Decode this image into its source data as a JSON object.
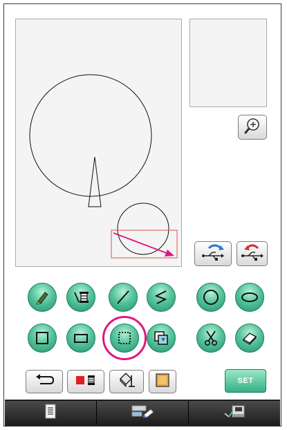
{
  "toolbar": {
    "set_label": "SET"
  },
  "icons": {
    "zoom": "zoom-in-magnifier-icon",
    "usb_save": "usb-save-icon",
    "usb_load": "usb-load-icon",
    "tools_row1": [
      "pencil-icon",
      "line-property-icon",
      "straight-line-icon",
      "polyline-icon",
      "circle-icon",
      "ellipse-icon"
    ],
    "tools_row2": [
      "square-icon",
      "rectangle-icon",
      "select-area-icon",
      "copy-paste-icon",
      "scissors-icon",
      "eraser-icon"
    ],
    "bottom": [
      "undo-icon",
      "color-picker-icon",
      "fill-bucket-icon",
      "line-fill-select-icon"
    ],
    "tabs": [
      "document-icon",
      "edit-stitch-icon",
      "sewing-machine-icon"
    ]
  },
  "colors": {
    "accent_green": "#34b083",
    "selection_ring": "#e0177f",
    "selection_box": "#e05050",
    "arrow": "#e0177f"
  },
  "state": {
    "selected_tool": "select-area"
  }
}
